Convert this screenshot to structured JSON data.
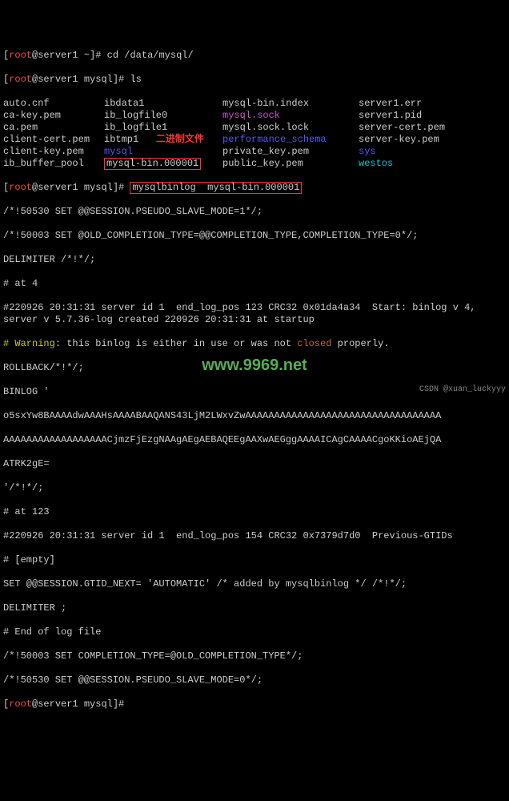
{
  "prompt": {
    "user": "root",
    "host": "server1",
    "home_dir": "~",
    "cwd": "mysql",
    "cmd_cd": "cd /data/mysql/",
    "cmd_ls": "ls",
    "cmd_binlog": "mysqlbinlog  mysql-bin.000001"
  },
  "ls": {
    "col1": [
      "auto.cnf",
      "ca-key.pem",
      "ca.pem",
      "client-cert.pem",
      "client-key.pem",
      "ib_buffer_pool"
    ],
    "col2": [
      "ibdata1",
      "ib_logfile0",
      "ib_logfile1",
      "ibtmp1",
      "mysql",
      "mysql-bin.000001"
    ],
    "col3": [
      "mysql-bin.index",
      "mysql.sock",
      "mysql.sock.lock",
      "performance_schema",
      "private_key.pem",
      "public_key.pem"
    ],
    "col4": [
      "server1.err",
      "server1.pid",
      "server-cert.pem",
      "server-key.pem",
      "sys",
      "westos"
    ]
  },
  "annot": "二进制文件",
  "body": [
    "/*!50530 SET @@SESSION.PSEUDO_SLAVE_MODE=1*/;",
    "/*!50003 SET @OLD_COMPLETION_TYPE=@@COMPLETION_TYPE,COMPLETION_TYPE=0*/;",
    "DELIMITER /*!*/;",
    "# at 4",
    "#220926 20:31:31 server id 1  end_log_pos 123 CRC32 0x01da4a34  Start: binlog v 4, server v 5.7.36-log created 220926 20:31:31 at startup"
  ],
  "warning": {
    "label": "# Warning",
    "pre": ": this binlog is either in use or was not ",
    "closed": "closed",
    "post": " properly."
  },
  "body2": [
    "ROLLBACK/*!*/;",
    "BINLOG '",
    "o5sxYw8BAAAAdwAAAHsAAAABAAQANS43LjM2LWxvZwAAAAAAAAAAAAAAAAAAAAAAAAAAAAAAAAAA",
    "AAAAAAAAAAAAAAAAAACjmzFjEzgNAAgAEgAEBAQEEgAAXwAEGggAAAAICAgCAAAACgoKKioAEjQA",
    "ATRK2gE=",
    "'/*!*/;",
    "# at 123",
    "#220926 20:31:31 server id 1  end_log_pos 154 CRC32 0x7379d7d0  Previous-GTIDs",
    "# [empty]",
    "SET @@SESSION.GTID_NEXT= 'AUTOMATIC' /* added by mysqlbinlog */ /*!*/;",
    "DELIMITER ;",
    "# End of log file",
    "/*!50003 SET COMPLETION_TYPE=@OLD_COMPLETION_TYPE*/;",
    "/*!50530 SET @@SESSION.PSEUDO_SLAVE_MODE=0*/;"
  ],
  "watermark": "www.9969.net",
  "credit": "CSDN @xuan_luckyyy"
}
